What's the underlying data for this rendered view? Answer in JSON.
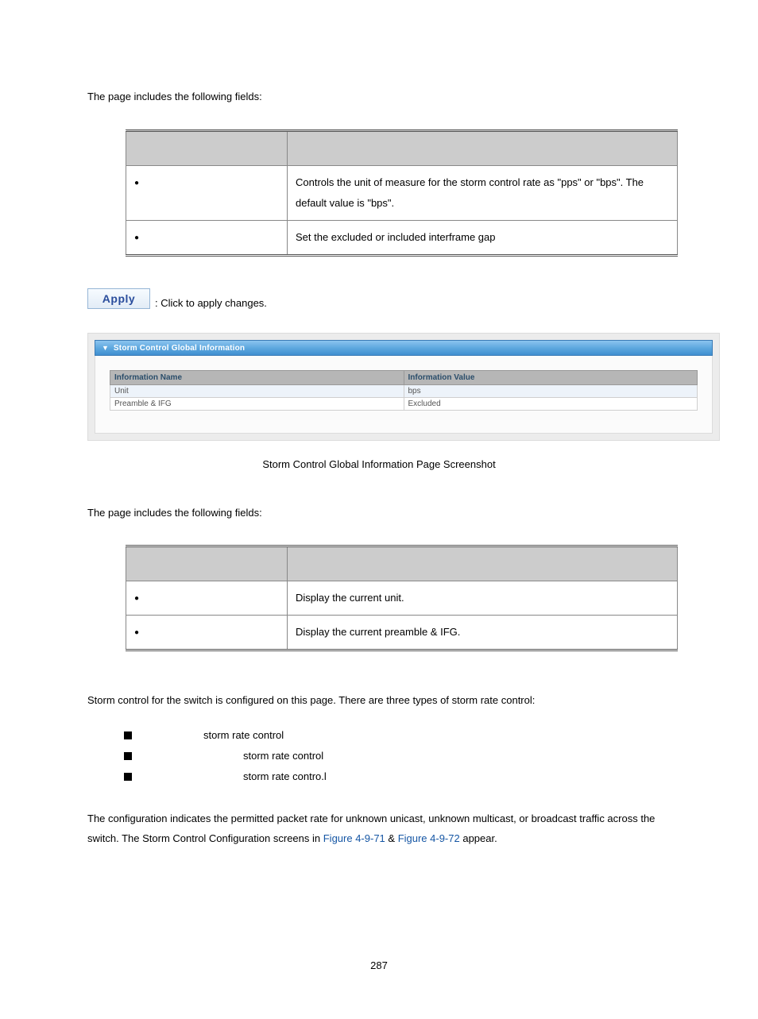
{
  "intro1": "The page includes the following fields:",
  "table1": {
    "headers": [
      "",
      ""
    ],
    "rows": [
      {
        "obj": "",
        "desc": "Controls the unit of measure for the storm control rate as \"pps\" or \"bps\". The default value is \"bps\"."
      },
      {
        "obj": "",
        "desc": "Set the excluded or included interframe gap"
      }
    ]
  },
  "buttons_prefix": "",
  "apply_label": "Apply",
  "apply_desc": ": Click to apply changes.",
  "panel": {
    "title": "Storm Control Global Information",
    "headers": [
      "Information Name",
      "Information Value"
    ],
    "rows": [
      {
        "name": "Unit",
        "value": "bps"
      },
      {
        "name": "Preamble & IFG",
        "value": "Excluded"
      }
    ]
  },
  "screenshot_caption": "Storm Control Global Information Page Screenshot",
  "intro2": "The page includes the following fields:",
  "table2": {
    "headers": [
      "",
      ""
    ],
    "rows": [
      {
        "obj": "",
        "desc": "Display the current unit."
      },
      {
        "obj": "",
        "desc": "Display the current preamble & IFG."
      }
    ]
  },
  "storm_intro": "Storm control for the switch is configured on this page. There are three types of storm rate control:",
  "storm_items": [
    "storm rate control",
    "storm rate control",
    "storm rate contro.l"
  ],
  "config_para_before": "The configuration indicates the permitted packet rate for unknown unicast, unknown multicast, or broadcast traffic across the switch. The Storm Control Configuration screens in ",
  "fig1": "Figure 4-9-71",
  "amp": " & ",
  "fig2": "Figure 4-9-72",
  "config_para_after": " appear.",
  "page_number": "287"
}
